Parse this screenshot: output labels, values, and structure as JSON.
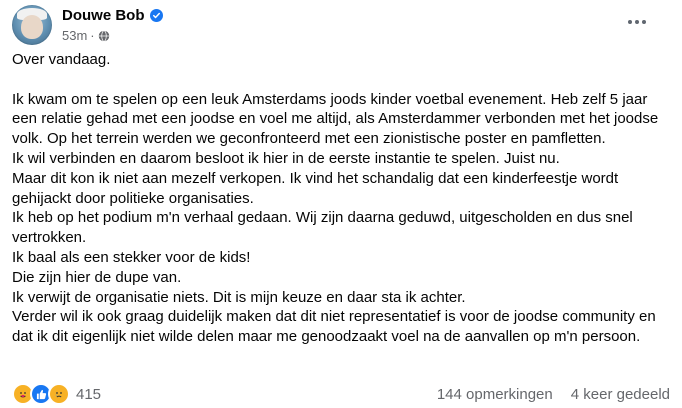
{
  "post": {
    "author": "Douwe Bob",
    "time": "53m",
    "separator": "·",
    "lines": [
      "Over vandaag.",
      "Ik kwam om te spelen op een leuk Amsterdams joods kinder voetbal evenement. Heb zelf 5 jaar een relatie gehad met een joodse en voel me altijd, als Amsterdammer verbonden met het joodse volk. Op het terrein werden we geconfronteerd met een zionistische poster en pamfletten.",
      "Ik wil verbinden en daarom besloot ik hier in de eerste instantie te spelen. Juist nu.",
      "Maar dit kon ik niet aan mezelf verkopen. Ik vind het schandalig dat een kinderfeestje wordt gehijackt door politieke organisaties.",
      "Ik heb op het podium m'n verhaal gedaan. Wij zijn daarna geduwd, uitgescholden en dus snel vertrokken.",
      "Ik baal als een stekker voor de kids!",
      "Die zijn hier de dupe van.",
      "Ik verwijt de organisatie niets. Dit is mijn keuze en daar sta ik achter.",
      "Verder wil ik ook graag duidelijk maken dat dit niet representatief is voor de joodse community en dat ik dit eigenlijk niet wilde delen maar me genoodzaakt voel na de aanvallen op m'n persoon."
    ],
    "reaction_count": "415",
    "comments": "144 opmerkingen",
    "shares": "4 keer gedeeld"
  },
  "icons": {
    "verified": "verified-badge-icon",
    "audience": "globe-icon",
    "more": "more-options-icon",
    "reactions": [
      "care-reaction-icon",
      "like-reaction-icon",
      "sad-reaction-icon"
    ]
  },
  "colors": {
    "verified": "#1877f2",
    "secondary_text": "#65676b",
    "like": "#1877f2",
    "care": "#f7b125"
  }
}
